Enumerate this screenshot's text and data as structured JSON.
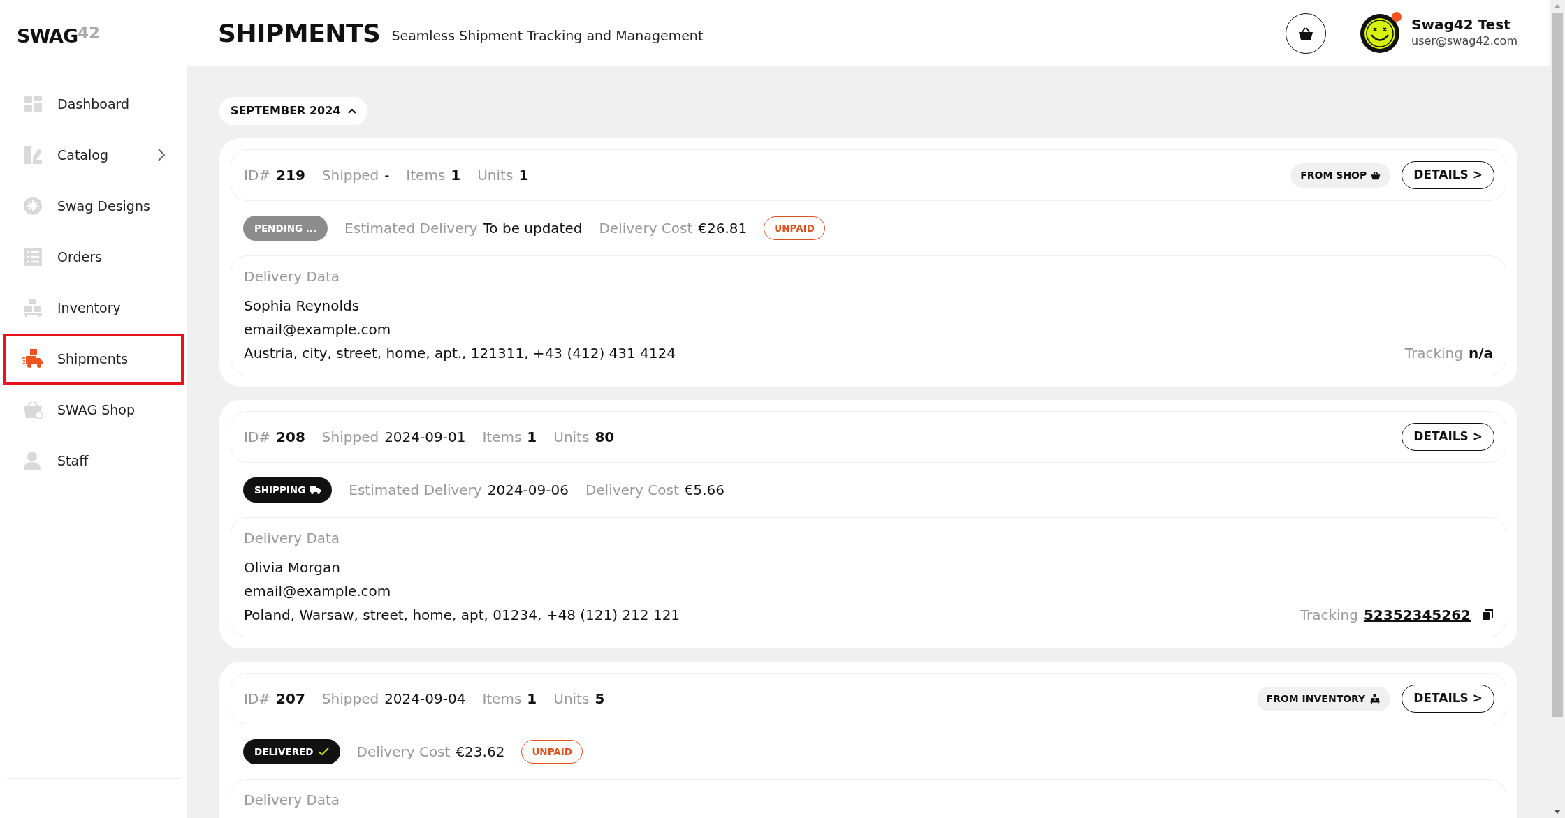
{
  "logo": {
    "text": "SWAG",
    "suffix": "42"
  },
  "sidebar": {
    "items": [
      {
        "label": "Dashboard",
        "kind": "dashboard",
        "selected": false,
        "expandable": false
      },
      {
        "label": "Catalog",
        "kind": "catalog",
        "selected": false,
        "expandable": true
      },
      {
        "label": "Swag Designs",
        "kind": "designs",
        "selected": false,
        "expandable": false
      },
      {
        "label": "Orders",
        "kind": "orders",
        "selected": false,
        "expandable": false
      },
      {
        "label": "Inventory",
        "kind": "inventory",
        "selected": false,
        "expandable": false
      },
      {
        "label": "Shipments",
        "kind": "shipments",
        "selected": true,
        "expandable": false
      },
      {
        "label": "SWAG Shop",
        "kind": "shop",
        "selected": false,
        "expandable": false
      },
      {
        "label": "Staff",
        "kind": "staff",
        "selected": false,
        "expandable": false
      }
    ]
  },
  "header": {
    "title": "SHIPMENTS",
    "subtitle": "Seamless Shipment Tracking and Management",
    "user": {
      "name": "Swag42 Test",
      "email": "user@swag42.com",
      "notification": true
    }
  },
  "month_filter": {
    "label": "SEPTEMBER 2024",
    "expanded": true
  },
  "shipments": [
    {
      "fields": [
        {
          "label": "ID#",
          "value": "219",
          "strong": true
        },
        {
          "label": "Shipped",
          "value": "-",
          "strong": false
        },
        {
          "label": "Items",
          "value": "1",
          "strong": true
        },
        {
          "label": "Units",
          "value": "1",
          "strong": true
        }
      ],
      "source": {
        "kind": "shop",
        "label": "FROM SHOP"
      },
      "details": "DETAILS >",
      "status": {
        "kind": "pending",
        "label": "PENDING ..."
      },
      "info": [
        {
          "label": "Estimated Delivery",
          "value": "To be updated"
        },
        {
          "label": "Delivery Cost",
          "value": "€26.81"
        }
      ],
      "payment": "UNPAID",
      "delivery": {
        "heading": "Delivery Data",
        "lines": [
          "Sophia Reynolds",
          "email@example.com",
          "Austria, city, street, home, apt., 121311, +43 (412) 431 4124"
        ]
      },
      "tracking": {
        "label": "Tracking",
        "value": "n/a",
        "kind": "none"
      }
    },
    {
      "fields": [
        {
          "label": "ID#",
          "value": "208",
          "strong": true
        },
        {
          "label": "Shipped",
          "value": "2024-09-01",
          "strong": false
        },
        {
          "label": "Items",
          "value": "1",
          "strong": true
        },
        {
          "label": "Units",
          "value": "80",
          "strong": true
        }
      ],
      "details": "DETAILS >",
      "status": {
        "kind": "shipping",
        "label": "SHIPPING"
      },
      "info": [
        {
          "label": "Estimated Delivery",
          "value": "2024-09-06"
        },
        {
          "label": "Delivery Cost",
          "value": "€5.66"
        }
      ],
      "delivery": {
        "heading": "Delivery Data",
        "lines": [
          "Olivia Morgan",
          "email@example.com",
          "Poland, Warsaw, street, home, apt, 01234, +48 (121) 212 121"
        ]
      },
      "tracking": {
        "label": "Tracking",
        "value": "52352345262",
        "kind": "link"
      }
    },
    {
      "fields": [
        {
          "label": "ID#",
          "value": "207",
          "strong": true
        },
        {
          "label": "Shipped",
          "value": "2024-09-04",
          "strong": false
        },
        {
          "label": "Items",
          "value": "1",
          "strong": true
        },
        {
          "label": "Units",
          "value": "5",
          "strong": true
        }
      ],
      "source": {
        "kind": "inventory",
        "label": "FROM INVENTORY"
      },
      "details": "DETAILS >",
      "status": {
        "kind": "delivered",
        "label": "DELIVERED"
      },
      "info": [
        {
          "label": "Delivery Cost",
          "value": "€23.62"
        }
      ],
      "payment": "UNPAID",
      "delivery": {
        "heading": "Delivery Data"
      }
    }
  ]
}
